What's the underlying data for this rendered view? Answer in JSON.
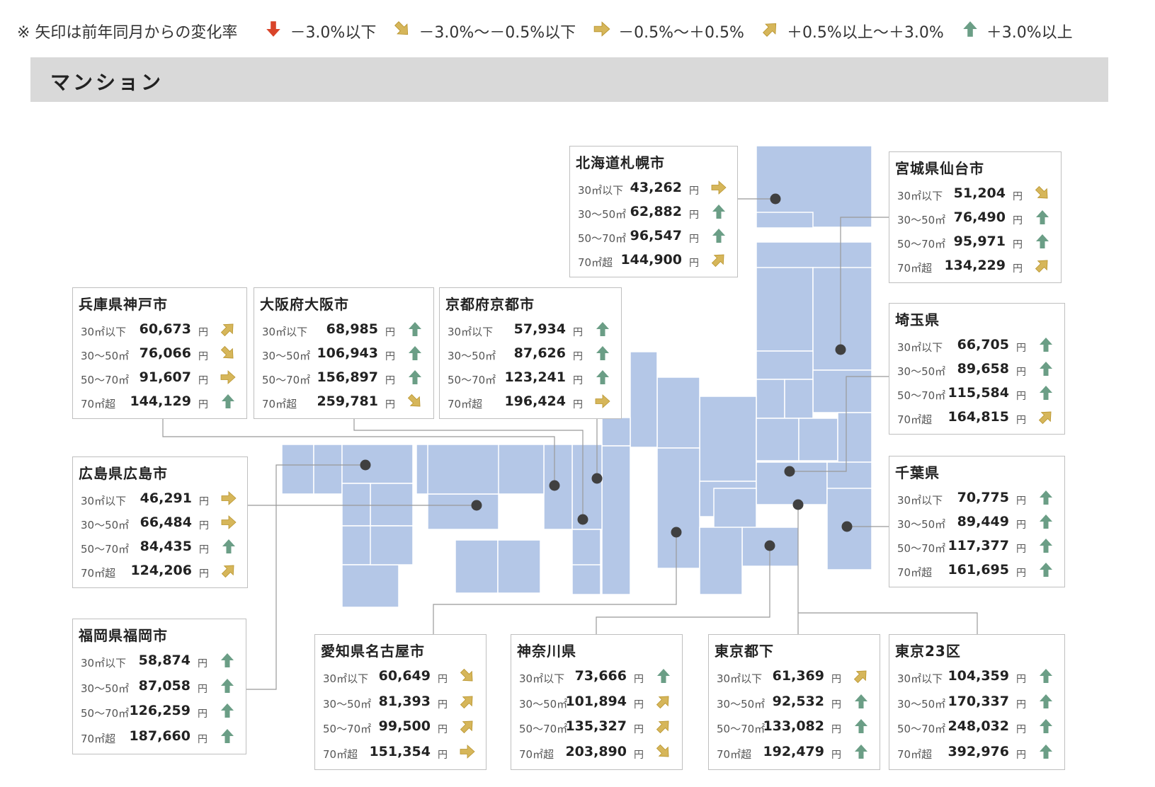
{
  "legend": {
    "note": "※ 矢印は前年同月からの変化率",
    "items": [
      {
        "arrow": "down",
        "label": "－3.0%以下"
      },
      {
        "arrow": "down-right",
        "label": "－3.0%～－0.5%以下"
      },
      {
        "arrow": "right",
        "label": "－0.5%～＋0.5%"
      },
      {
        "arrow": "up-right",
        "label": "＋0.5%以上～＋3.0%"
      },
      {
        "arrow": "up",
        "label": "＋3.0%以上"
      }
    ]
  },
  "section": {
    "title": "マンション"
  },
  "colors": {
    "map_fill": "#b4c7e7",
    "map_border": "#ffffff",
    "card_border": "#bfbfbf",
    "arrow_down": "#d9442a",
    "arrow_down_right": "#d6b65a",
    "arrow_right": "#d6b65a",
    "arrow_up_right": "#d6b65a",
    "arrow_up": "#6b9e86",
    "section_bg": "#d9d9d9",
    "dot": "#404040",
    "leader": "#999999"
  },
  "yen": "円",
  "chart_data": {
    "type": "table",
    "categories": [
      "30㎡以下",
      "30～50㎡",
      "50～70㎡",
      "70㎡超"
    ],
    "regions": [
      {
        "name": "北海道札幌市",
        "rows": [
          {
            "size": "30㎡以下",
            "value": "43,262",
            "arrow": "right"
          },
          {
            "size": "30～50㎡",
            "value": "62,882",
            "arrow": "up"
          },
          {
            "size": "50～70㎡",
            "value": "96,547",
            "arrow": "up"
          },
          {
            "size": "70㎡超",
            "value": "144,900",
            "arrow": "up-right"
          }
        ]
      },
      {
        "name": "宮城県仙台市",
        "rows": [
          {
            "size": "30㎡以下",
            "value": "51,204",
            "arrow": "down-right"
          },
          {
            "size": "30～50㎡",
            "value": "76,490",
            "arrow": "up"
          },
          {
            "size": "50～70㎡",
            "value": "95,971",
            "arrow": "up"
          },
          {
            "size": "70㎡超",
            "value": "134,229",
            "arrow": "up-right"
          }
        ]
      },
      {
        "name": "兵庫県神戸市",
        "rows": [
          {
            "size": "30㎡以下",
            "value": "60,673",
            "arrow": "up-right"
          },
          {
            "size": "30～50㎡",
            "value": "76,066",
            "arrow": "down-right"
          },
          {
            "size": "50～70㎡",
            "value": "91,607",
            "arrow": "right"
          },
          {
            "size": "70㎡超",
            "value": "144,129",
            "arrow": "up"
          }
        ]
      },
      {
        "name": "大阪府大阪市",
        "rows": [
          {
            "size": "30㎡以下",
            "value": "68,985",
            "arrow": "up"
          },
          {
            "size": "30～50㎡",
            "value": "106,943",
            "arrow": "up"
          },
          {
            "size": "50～70㎡",
            "value": "156,897",
            "arrow": "up"
          },
          {
            "size": "70㎡超",
            "value": "259,781",
            "arrow": "down-right"
          }
        ]
      },
      {
        "name": "京都府京都市",
        "rows": [
          {
            "size": "30㎡以下",
            "value": "57,934",
            "arrow": "up"
          },
          {
            "size": "30～50㎡",
            "value": "87,626",
            "arrow": "up"
          },
          {
            "size": "50～70㎡",
            "value": "123,241",
            "arrow": "up"
          },
          {
            "size": "70㎡超",
            "value": "196,424",
            "arrow": "right"
          }
        ]
      },
      {
        "name": "埼玉県",
        "rows": [
          {
            "size": "30㎡以下",
            "value": "66,705",
            "arrow": "up"
          },
          {
            "size": "30～50㎡",
            "value": "89,658",
            "arrow": "up"
          },
          {
            "size": "50～70㎡",
            "value": "115,584",
            "arrow": "up"
          },
          {
            "size": "70㎡超",
            "value": "164,815",
            "arrow": "up-right"
          }
        ]
      },
      {
        "name": "広島県広島市",
        "rows": [
          {
            "size": "30㎡以下",
            "value": "46,291",
            "arrow": "right"
          },
          {
            "size": "30～50㎡",
            "value": "66,484",
            "arrow": "right"
          },
          {
            "size": "50～70㎡",
            "value": "84,435",
            "arrow": "up"
          },
          {
            "size": "70㎡超",
            "value": "124,206",
            "arrow": "up-right"
          }
        ]
      },
      {
        "name": "千葉県",
        "rows": [
          {
            "size": "30㎡以下",
            "value": "70,775",
            "arrow": "up"
          },
          {
            "size": "30～50㎡",
            "value": "89,449",
            "arrow": "up"
          },
          {
            "size": "50～70㎡",
            "value": "117,377",
            "arrow": "up"
          },
          {
            "size": "70㎡超",
            "value": "161,695",
            "arrow": "up"
          }
        ]
      },
      {
        "name": "福岡県福岡市",
        "rows": [
          {
            "size": "30㎡以下",
            "value": "58,874",
            "arrow": "up"
          },
          {
            "size": "30～50㎡",
            "value": "87,058",
            "arrow": "up"
          },
          {
            "size": "50～70㎡",
            "value": "126,259",
            "arrow": "up"
          },
          {
            "size": "70㎡超",
            "value": "187,660",
            "arrow": "up"
          }
        ]
      },
      {
        "name": "愛知県名古屋市",
        "rows": [
          {
            "size": "30㎡以下",
            "value": "60,649",
            "arrow": "down-right"
          },
          {
            "size": "30～50㎡",
            "value": "81,393",
            "arrow": "up-right"
          },
          {
            "size": "50～70㎡",
            "value": "99,500",
            "arrow": "up-right"
          },
          {
            "size": "70㎡超",
            "value": "151,354",
            "arrow": "right"
          }
        ]
      },
      {
        "name": "神奈川県",
        "rows": [
          {
            "size": "30㎡以下",
            "value": "73,666",
            "arrow": "up"
          },
          {
            "size": "30～50㎡",
            "value": "101,894",
            "arrow": "up-right"
          },
          {
            "size": "50～70㎡",
            "value": "135,327",
            "arrow": "up-right"
          },
          {
            "size": "70㎡超",
            "value": "203,890",
            "arrow": "down-right"
          }
        ]
      },
      {
        "name": "東京都下",
        "rows": [
          {
            "size": "30㎡以下",
            "value": "61,369",
            "arrow": "up-right"
          },
          {
            "size": "30～50㎡",
            "value": "92,532",
            "arrow": "up"
          },
          {
            "size": "50～70㎡",
            "value": "133,082",
            "arrow": "up"
          },
          {
            "size": "70㎡超",
            "value": "192,479",
            "arrow": "up"
          }
        ]
      },
      {
        "name": "東京23区",
        "rows": [
          {
            "size": "30㎡以下",
            "value": "104,359",
            "arrow": "up"
          },
          {
            "size": "30～50㎡",
            "value": "170,337",
            "arrow": "up"
          },
          {
            "size": "50～70㎡",
            "value": "248,032",
            "arrow": "up"
          },
          {
            "size": "70㎡超",
            "value": "392,976",
            "arrow": "up"
          }
        ]
      }
    ]
  }
}
